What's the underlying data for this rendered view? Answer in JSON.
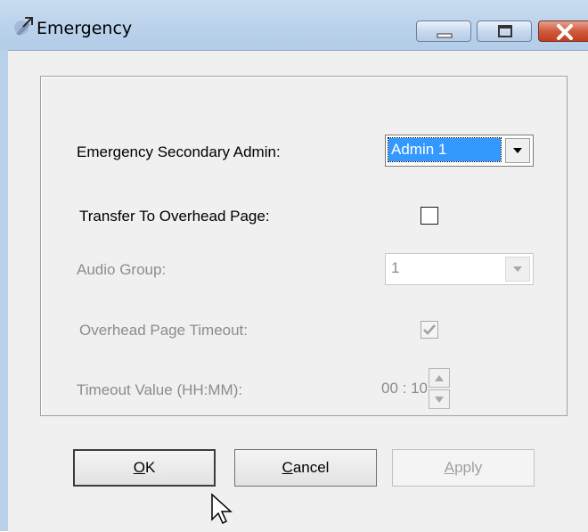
{
  "window": {
    "title": "Emergency",
    "app_icon": "pen-icon",
    "controls": [
      "minimize-icon",
      "maximize-icon",
      "close-icon"
    ]
  },
  "form": {
    "secondary_admin": {
      "label": "Emergency Secondary Admin:",
      "value": "Admin 1",
      "enabled": true
    },
    "transfer_overhead": {
      "label": "Transfer To Overhead Page:",
      "checked": false,
      "enabled": true
    },
    "audio_group": {
      "label": "Audio Group:",
      "value": "1",
      "enabled": false
    },
    "overhead_timeout": {
      "label": "Overhead Page Timeout:",
      "checked": true,
      "enabled": false
    },
    "timeout_value": {
      "label": "Timeout Value (HH:MM):",
      "value": "00 : 10",
      "enabled": false
    }
  },
  "buttons": {
    "ok": {
      "underline": "O",
      "rest": "K"
    },
    "cancel": {
      "underline": "C",
      "rest": "ancel"
    },
    "apply": {
      "underline": "A",
      "rest": "pply",
      "enabled": false
    }
  }
}
